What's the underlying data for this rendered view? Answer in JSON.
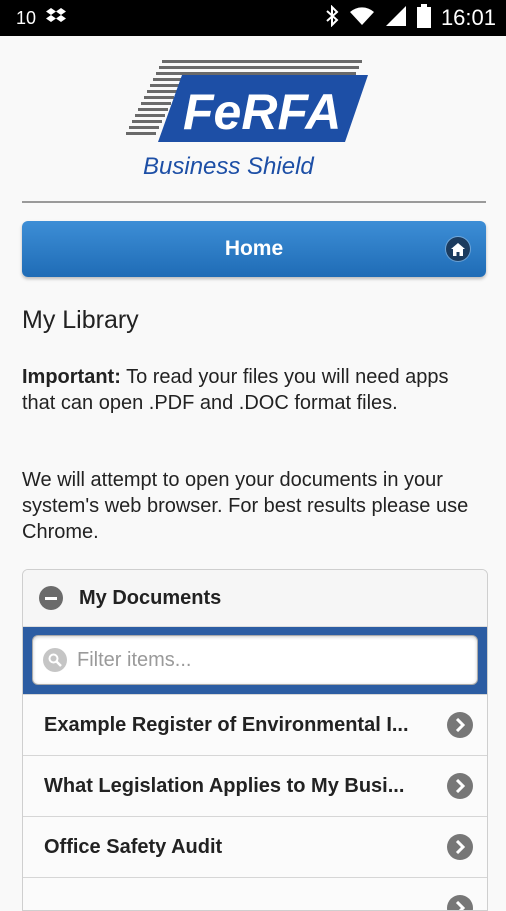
{
  "statusbar": {
    "signal_text": "10",
    "time": "16:01"
  },
  "logo": {
    "brand": "FeRFA",
    "tagline": "Business Shield"
  },
  "header": {
    "home_label": "Home"
  },
  "page": {
    "title": "My Library",
    "important_label": "Important:",
    "important_text": " To read your files you will need apps that can open .PDF and .DOC format files.",
    "browser_text": "We will attempt to open your documents in your system's web browser. For best results please use Chrome."
  },
  "documents": {
    "heading": "My Documents",
    "filter_placeholder": "Filter items...",
    "items": [
      {
        "label": "Example Register of Environmental I..."
      },
      {
        "label": "What Legislation Applies to My Busi..."
      },
      {
        "label": "Office Safety Audit"
      },
      {
        "label": ""
      }
    ]
  },
  "colors": {
    "brand_blue": "#1d4fa6",
    "accent_bar": "#2c5da3",
    "home_bar": "#2a79c3"
  }
}
